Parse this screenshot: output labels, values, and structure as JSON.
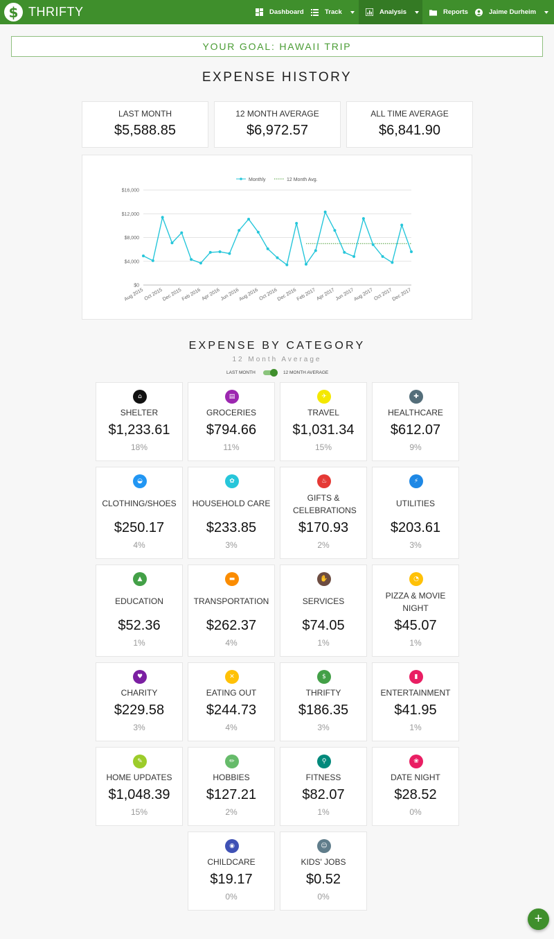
{
  "app": {
    "name": "THRIFTY",
    "logo_symbol": "$"
  },
  "nav": {
    "dashboard": "Dashboard",
    "track": "Track",
    "analysis": "Analysis",
    "reports": "Reports",
    "user": "Jaime Durheim"
  },
  "goal": {
    "text": "YOUR GOAL: HAWAII TRIP"
  },
  "expense_history": {
    "title": "EXPENSE HISTORY",
    "last_month": {
      "label": "LAST MONTH",
      "value": "$5,588.85"
    },
    "twelve_month": {
      "label": "12 MONTH AVERAGE",
      "value": "$6,972.57"
    },
    "all_time": {
      "label": "ALL TIME AVERAGE",
      "value": "$6,841.90"
    }
  },
  "chart_data": {
    "type": "line",
    "legend": {
      "monthly": "Monthly",
      "average": "12 Month Avg.",
      "placement": "top"
    },
    "ylim": [
      0,
      16000
    ],
    "y_ticks": [
      "$0",
      "$4,000",
      "$8,000",
      "$12,000",
      "$16,000"
    ],
    "y_tick_values": [
      0,
      4000,
      8000,
      12000,
      16000
    ],
    "x_tick_labels": [
      "Aug 2015",
      "Oct 2015",
      "Dec 2015",
      "Feb 2016",
      "Apr 2016",
      "Jun 2016",
      "Aug 2016",
      "Oct 2016",
      "Dec 2016",
      "Feb 2017",
      "Apr 2017",
      "Jun 2017",
      "Aug 2017",
      "Oct 2017",
      "Dec 2017"
    ],
    "series": [
      {
        "name": "Monthly",
        "color": "#26c6da",
        "values": [
          4900,
          4100,
          11400,
          7100,
          8800,
          4300,
          3700,
          5500,
          5600,
          5300,
          9200,
          11100,
          8900,
          6100,
          4600,
          3400,
          10400,
          3500,
          5800,
          12300,
          9200,
          5500,
          4800,
          11200,
          6800,
          4800,
          3800,
          10100,
          5600
        ]
      },
      {
        "name": "12 Month Avg.",
        "color": "#4a9c34",
        "start_index": 17,
        "value": 6972.57
      }
    ],
    "grid": true
  },
  "by_category": {
    "title": "EXPENSE BY CATEGORY",
    "subtitle": "12 Month Average",
    "toggle_left": "LAST MONTH",
    "toggle_right": "12 MONTH AVERAGE",
    "categories": [
      {
        "name": "SHELTER",
        "amount": "$1,233.61",
        "pct": "18%",
        "color": "#111111",
        "icon": "home-icon",
        "glyph": "⌂"
      },
      {
        "name": "GROCERIES",
        "amount": "$794.66",
        "pct": "11%",
        "color": "#9c27b0",
        "icon": "receipt-icon",
        "glyph": "▤"
      },
      {
        "name": "TRAVEL",
        "amount": "$1,031.34",
        "pct": "15%",
        "color": "#f4e800",
        "icon": "airplane-icon",
        "glyph": "✈"
      },
      {
        "name": "HEALTHCARE",
        "amount": "$612.07",
        "pct": "9%",
        "color": "#546e7a",
        "icon": "medical-icon",
        "glyph": "✚"
      },
      {
        "name": "CLOTHING/SHOES",
        "amount": "$250.17",
        "pct": "4%",
        "color": "#2196f3",
        "icon": "basket-icon",
        "glyph": "◒"
      },
      {
        "name": "HOUSEHOLD CARE",
        "amount": "$233.85",
        "pct": "3%",
        "color": "#26c6da",
        "icon": "broom-icon",
        "glyph": "✿"
      },
      {
        "name": "GIFTS & CELEBRATIONS",
        "amount": "$170.93",
        "pct": "2%",
        "color": "#e53935",
        "icon": "cake-icon",
        "glyph": "♨"
      },
      {
        "name": "UTILITIES",
        "amount": "$203.61",
        "pct": "3%",
        "color": "#1e88e5",
        "icon": "plug-icon",
        "glyph": "⚡"
      },
      {
        "name": "EDUCATION",
        "amount": "$52.36",
        "pct": "1%",
        "color": "#43a047",
        "icon": "graduation-cap-icon",
        "glyph": "▲"
      },
      {
        "name": "TRANSPORTATION",
        "amount": "$262.37",
        "pct": "4%",
        "color": "#fb8c00",
        "icon": "car-icon",
        "glyph": "▬"
      },
      {
        "name": "SERVICES",
        "amount": "$74.05",
        "pct": "1%",
        "color": "#6d4c41",
        "icon": "hand-icon",
        "glyph": "✋"
      },
      {
        "name": "PIZZA & MOVIE NIGHT",
        "amount": "$45.07",
        "pct": "1%",
        "color": "#ffc107",
        "icon": "pizza-icon",
        "glyph": "◔"
      },
      {
        "name": "CHARITY",
        "amount": "$229.58",
        "pct": "3%",
        "color": "#7b1fa2",
        "icon": "heart-icon",
        "glyph": "♥"
      },
      {
        "name": "EATING OUT",
        "amount": "$244.73",
        "pct": "4%",
        "color": "#ffc107",
        "icon": "utensils-icon",
        "glyph": "✕"
      },
      {
        "name": "THRIFTY",
        "amount": "$186.35",
        "pct": "3%",
        "color": "#43a047",
        "icon": "dollar-icon",
        "glyph": "$"
      },
      {
        "name": "ENTERTAINMENT",
        "amount": "$41.95",
        "pct": "1%",
        "color": "#e91e63",
        "icon": "film-icon",
        "glyph": "▮"
      },
      {
        "name": "HOME UPDATES",
        "amount": "$1,048.39",
        "pct": "15%",
        "color": "#9ccc2a",
        "icon": "wrench-icon",
        "glyph": "✎"
      },
      {
        "name": "HOBBIES",
        "amount": "$127.21",
        "pct": "2%",
        "color": "#66bb6a",
        "icon": "brush-icon",
        "glyph": "✏"
      },
      {
        "name": "FITNESS",
        "amount": "$82.07",
        "pct": "1%",
        "color": "#00897b",
        "icon": "bicycle-icon",
        "glyph": "⚲"
      },
      {
        "name": "DATE NIGHT",
        "amount": "$28.52",
        "pct": "0%",
        "color": "#e91e63",
        "icon": "rose-icon",
        "glyph": "❀"
      },
      {
        "name": "CHILDCARE",
        "amount": "$19.17",
        "pct": "0%",
        "color": "#3f51b5",
        "icon": "stroller-icon",
        "glyph": "◉"
      },
      {
        "name": "KIDS' JOBS",
        "amount": "$0.52",
        "pct": "0%",
        "color": "#607d8b",
        "icon": "child-face-icon",
        "glyph": "☺"
      }
    ]
  },
  "fab": {
    "label": "+"
  }
}
